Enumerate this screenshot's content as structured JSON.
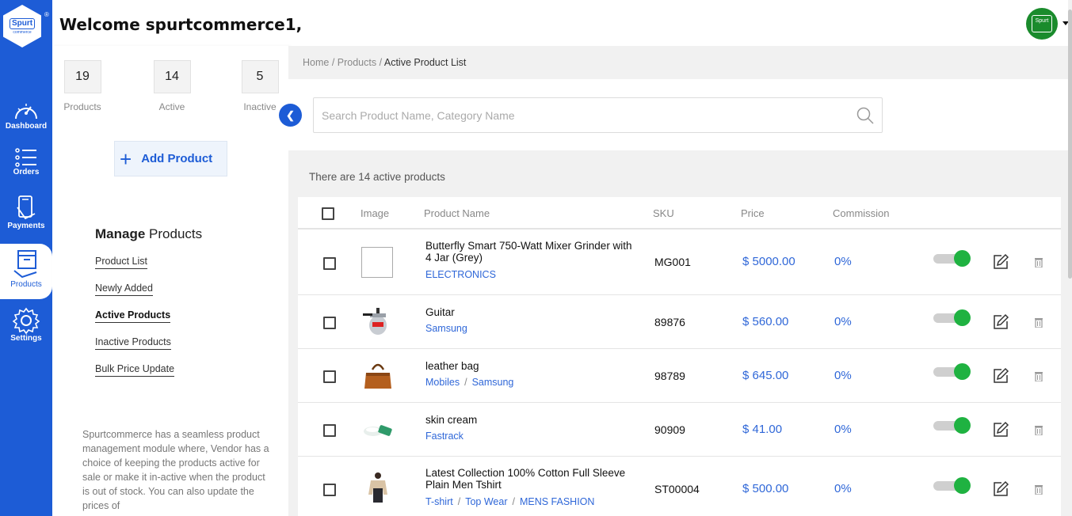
{
  "logo": {
    "line1": "Spurt",
    "line2": "commerce",
    "mark": "®"
  },
  "nav": [
    {
      "label": "Dashboard",
      "icon": "gauge-icon"
    },
    {
      "label": "Orders",
      "icon": "list-icon"
    },
    {
      "label": "Payments",
      "icon": "card-icon"
    },
    {
      "label": "Products",
      "icon": "box-icon",
      "active": true
    },
    {
      "label": "Settings",
      "icon": "gear-icon"
    }
  ],
  "header": {
    "welcome": "Welcome spurtcommerce1,",
    "avatar_text": "Spurt"
  },
  "stats": [
    {
      "value": "19",
      "label": "Products"
    },
    {
      "value": "14",
      "label": "Active"
    },
    {
      "value": "5",
      "label": "Inactive"
    }
  ],
  "add_product_label": "Add Product",
  "manage": {
    "title_bold": "Manage",
    "title_rest": "Products",
    "links": [
      "Product List",
      "Newly Added",
      "Active Products",
      "Inactive Products",
      "Bulk Price Update"
    ],
    "selected": "Active Products"
  },
  "description": "Spurtcommerce has a seamless product management module where, Vendor has a choice of keeping the products active for sale or make it in-active when the product is out of stock. You can also update the prices of",
  "breadcrumb": [
    "Home",
    "Products",
    "Active Product List"
  ],
  "search": {
    "placeholder": "Search Product Name, Category Name",
    "value": ""
  },
  "count_text": "There are 14 active products",
  "table": {
    "headers": [
      "Image",
      "Product Name",
      "SKU",
      "Price",
      "Commission"
    ],
    "rows": [
      {
        "name": "Butterfly Smart 750-Watt Mixer Grinder with 4 Jar (Grey)",
        "categories": [
          "ELECTRONICS"
        ],
        "sku": "MG001",
        "price": "$ 5000.00",
        "commission": "0%",
        "image": "broken-image",
        "active": true
      },
      {
        "name": "Guitar",
        "categories": [
          "Samsung"
        ],
        "sku": "89876",
        "price": "$ 560.00",
        "commission": "0%",
        "image": "pressure-cooker-image",
        "active": true
      },
      {
        "name": "leather bag",
        "categories": [
          "Mobiles",
          "Samsung"
        ],
        "sku": "98789",
        "price": "$ 645.00",
        "commission": "0%",
        "image": "handbag-image",
        "active": true
      },
      {
        "name": "skin cream",
        "categories": [
          "Fastrack"
        ],
        "sku": "90909",
        "price": "$ 41.00",
        "commission": "0%",
        "image": "cream-image",
        "active": true
      },
      {
        "name": "Latest Collection 100% Cotton Full Sleeve Plain Men Tshirt",
        "categories": [
          "T-shirt",
          "Top Wear",
          "MENS FASHION"
        ],
        "sku": "ST00004",
        "price": "$ 500.00",
        "commission": "0%",
        "image": "tshirt-image",
        "active": true
      }
    ]
  },
  "colors": {
    "primary": "#1d5cd6",
    "toggle_on": "#1fb241",
    "link": "#2f67d8"
  }
}
